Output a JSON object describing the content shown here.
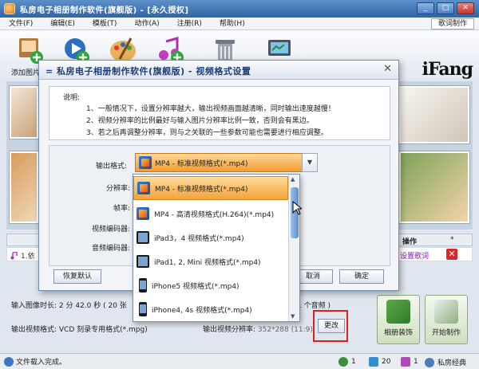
{
  "window": {
    "title": "私房电子相册制作软件(旗舰版) - [永久授权]"
  },
  "menu": {
    "items": [
      "文件(F)",
      "编辑(E)",
      "模板(T)",
      "动作(A)",
      "注册(R)",
      "帮助(H)"
    ],
    "lyric_button": "歌词制作"
  },
  "toolbar": {
    "add_label": "添加图片",
    "brand": "iFang"
  },
  "table": {
    "op_header": "操作",
    "star_header": "*",
    "row_name": "1.依",
    "row_link": "设置歌词"
  },
  "bottom": {
    "duration_label": "输入图像时长: 2 分 42.0 秒 ( 20 张",
    "audio_count": "1 个音频 )",
    "video_format_label": "输出视频格式: VCD 刻录专用格式(*.mpg)",
    "resolution_label": "输出视频分辨率: ",
    "resolution_value": "352*288 (11:9)",
    "change_button": "更改",
    "decorate_button": "相册装饰",
    "start_button": "开始制作"
  },
  "status": {
    "text": "文件载入完成。",
    "count1": "1",
    "count2": "20",
    "count3": "1",
    "brand": "私房经典"
  },
  "dialog": {
    "title": "= 私房电子相册制作软件(旗舰版) - 视频格式设置",
    "desc_title": "说明:",
    "desc_lines": [
      "1、一般情况下，设置分辨率越大，输出视频画面越清晰，同时输出速度越慢！",
      "2、视频分辨率的比例最好与输入图片分辨率比例一致，否则会有黑边。",
      "3、若之后再调整分辨率，则与之关联的一些参数可能也需要进行相应调整。"
    ],
    "labels": {
      "format": "输出格式:",
      "resolution": "分辨率:",
      "framerate": "帧率:",
      "vcodec": "视频编码器:",
      "acodec": "音频编码器:"
    },
    "selected_format": "MP4 - 标准视频格式(*.mp4)",
    "reset_button": "恢复默认",
    "cancel_button": "取消",
    "ok_button": "确定"
  },
  "dropdown": {
    "options": [
      {
        "label": "MP4 - 标准视频格式(*.mp4)",
        "icon": "mp4",
        "selected": true
      },
      {
        "label": "MP4 - 高清视频格式(H.264)(*.mp4)",
        "icon": "mp4",
        "selected": false
      },
      {
        "label": "iPad3，4 视频格式(*.mp4)",
        "icon": "ipad",
        "selected": false
      },
      {
        "label": "iPad1, 2, Mini 视频格式(*.mp4)",
        "icon": "ipad",
        "selected": false
      },
      {
        "label": "iPhone5 视频格式(*.mp4)",
        "icon": "iphone",
        "selected": false
      },
      {
        "label": "iPhone4, 4s 视频格式(*.mp4)",
        "icon": "iphone",
        "selected": false
      }
    ]
  },
  "colors": {
    "titlebar": "#2f65a8",
    "selection": "#f5a338",
    "highlight_box": "#e02020"
  }
}
